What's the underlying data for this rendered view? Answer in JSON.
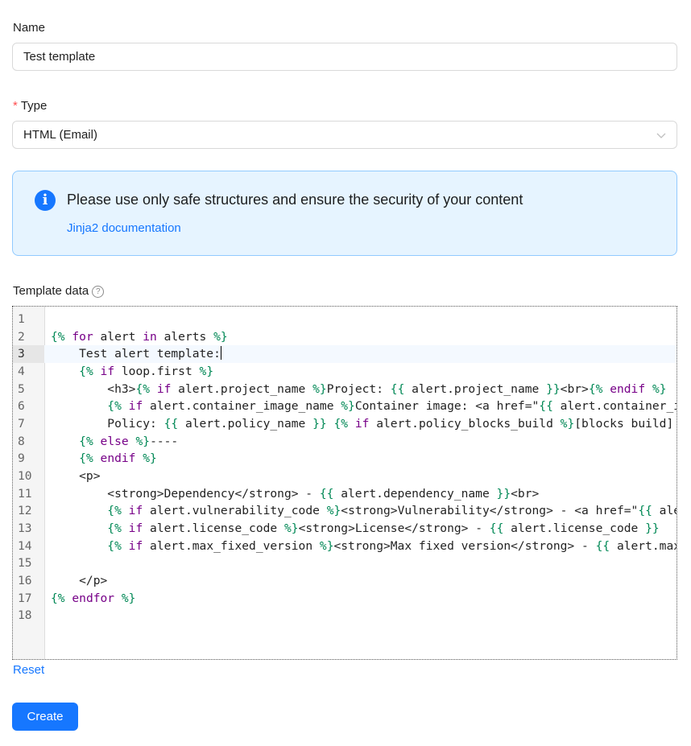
{
  "form": {
    "name_label": "Name",
    "name_value": "Test template",
    "type_required_mark": "*",
    "type_label": "Type",
    "type_value": "HTML (Email)",
    "template_data_label": "Template data",
    "help_glyph": "?",
    "reset_label": "Reset",
    "create_label": "Create"
  },
  "alert": {
    "icon": "info-icon",
    "icon_glyph": "i",
    "message": "Please use only safe structures and ensure the security of your content",
    "link_text": "Jinja2 documentation"
  },
  "editor": {
    "active_line": 3,
    "lines": [
      [],
      [
        [
          "t",
          "{%"
        ],
        [
          "s",
          " "
        ],
        [
          "k",
          "for"
        ],
        [
          "s",
          " alert "
        ],
        [
          "k",
          "in"
        ],
        [
          "s",
          " alerts "
        ],
        [
          "t",
          "%}"
        ]
      ],
      [
        [
          "s",
          "    Test alert template:"
        ]
      ],
      [
        [
          "s",
          "    "
        ],
        [
          "t",
          "{%"
        ],
        [
          "s",
          " "
        ],
        [
          "k",
          "if"
        ],
        [
          "s",
          " loop.first "
        ],
        [
          "t",
          "%}"
        ]
      ],
      [
        [
          "s",
          "        <h3>"
        ],
        [
          "t",
          "{%"
        ],
        [
          "s",
          " "
        ],
        [
          "k",
          "if"
        ],
        [
          "s",
          " alert.project_name "
        ],
        [
          "t",
          "%}"
        ],
        [
          "s",
          "Project: "
        ],
        [
          "t",
          "{{"
        ],
        [
          "s",
          " alert.project_name "
        ],
        [
          "t",
          "}}"
        ],
        [
          "s",
          "<br>"
        ],
        [
          "t",
          "{%"
        ],
        [
          "s",
          " "
        ],
        [
          "k",
          "endif"
        ],
        [
          "s",
          " "
        ],
        [
          "t",
          "%}"
        ]
      ],
      [
        [
          "s",
          "        "
        ],
        [
          "t",
          "{%"
        ],
        [
          "s",
          " "
        ],
        [
          "k",
          "if"
        ],
        [
          "s",
          " alert.container_image_name "
        ],
        [
          "t",
          "%}"
        ],
        [
          "s",
          "Container image: <a href=\""
        ],
        [
          "t",
          "{{"
        ],
        [
          "s",
          " alert.container_image_url "
        ],
        [
          "t",
          "}}"
        ],
        [
          "s",
          "\">"
        ]
      ],
      [
        [
          "s",
          "        Policy: "
        ],
        [
          "t",
          "{{"
        ],
        [
          "s",
          " alert.policy_name "
        ],
        [
          "t",
          "}}"
        ],
        [
          "s",
          " "
        ],
        [
          "t",
          "{%"
        ],
        [
          "s",
          " "
        ],
        [
          "k",
          "if"
        ],
        [
          "s",
          " alert.policy_blocks_build "
        ],
        [
          "t",
          "%}"
        ],
        [
          "s",
          "[blocks build]"
        ]
      ],
      [
        [
          "s",
          "    "
        ],
        [
          "t",
          "{%"
        ],
        [
          "s",
          " "
        ],
        [
          "k",
          "else"
        ],
        [
          "s",
          " "
        ],
        [
          "t",
          "%}"
        ],
        [
          "s",
          "----"
        ]
      ],
      [
        [
          "s",
          "    "
        ],
        [
          "t",
          "{%"
        ],
        [
          "s",
          " "
        ],
        [
          "k",
          "endif"
        ],
        [
          "s",
          " "
        ],
        [
          "t",
          "%}"
        ]
      ],
      [
        [
          "s",
          "    <p>"
        ]
      ],
      [
        [
          "s",
          "        <strong>Dependency</strong> - "
        ],
        [
          "t",
          "{{"
        ],
        [
          "s",
          " alert.dependency_name "
        ],
        [
          "t",
          "}}"
        ],
        [
          "s",
          "<br>"
        ]
      ],
      [
        [
          "s",
          "        "
        ],
        [
          "t",
          "{%"
        ],
        [
          "s",
          " "
        ],
        [
          "k",
          "if"
        ],
        [
          "s",
          " alert.vulnerability_code "
        ],
        [
          "t",
          "%}"
        ],
        [
          "s",
          "<strong>Vulnerability</strong> - <a href=\""
        ],
        [
          "t",
          "{{"
        ],
        [
          "s",
          " alert.vulnerability_url "
        ],
        [
          "t",
          "}}"
        ]
      ],
      [
        [
          "s",
          "        "
        ],
        [
          "t",
          "{%"
        ],
        [
          "s",
          " "
        ],
        [
          "k",
          "if"
        ],
        [
          "s",
          " alert.license_code "
        ],
        [
          "t",
          "%}"
        ],
        [
          "s",
          "<strong>License</strong> - "
        ],
        [
          "t",
          "{{"
        ],
        [
          "s",
          " alert.license_code "
        ],
        [
          "t",
          "}}"
        ]
      ],
      [
        [
          "s",
          "        "
        ],
        [
          "t",
          "{%"
        ],
        [
          "s",
          " "
        ],
        [
          "k",
          "if"
        ],
        [
          "s",
          " alert.max_fixed_version "
        ],
        [
          "t",
          "%}"
        ],
        [
          "s",
          "<strong>Max fixed version</strong> - "
        ],
        [
          "t",
          "{{"
        ],
        [
          "s",
          " alert.max_fixed_version "
        ],
        [
          "t",
          "}}"
        ]
      ],
      [],
      [
        [
          "s",
          "    </p>"
        ]
      ],
      [
        [
          "t",
          "{%"
        ],
        [
          "s",
          " "
        ],
        [
          "k",
          "endfor"
        ],
        [
          "s",
          " "
        ],
        [
          "t",
          "%}"
        ]
      ],
      []
    ]
  },
  "colors": {
    "primary": "#1677ff",
    "alert_bg": "#e6f4ff",
    "alert_border": "#91caff",
    "required": "#ff4d4f",
    "jinja_tag": "#008855",
    "jinja_keyword": "#770088"
  }
}
